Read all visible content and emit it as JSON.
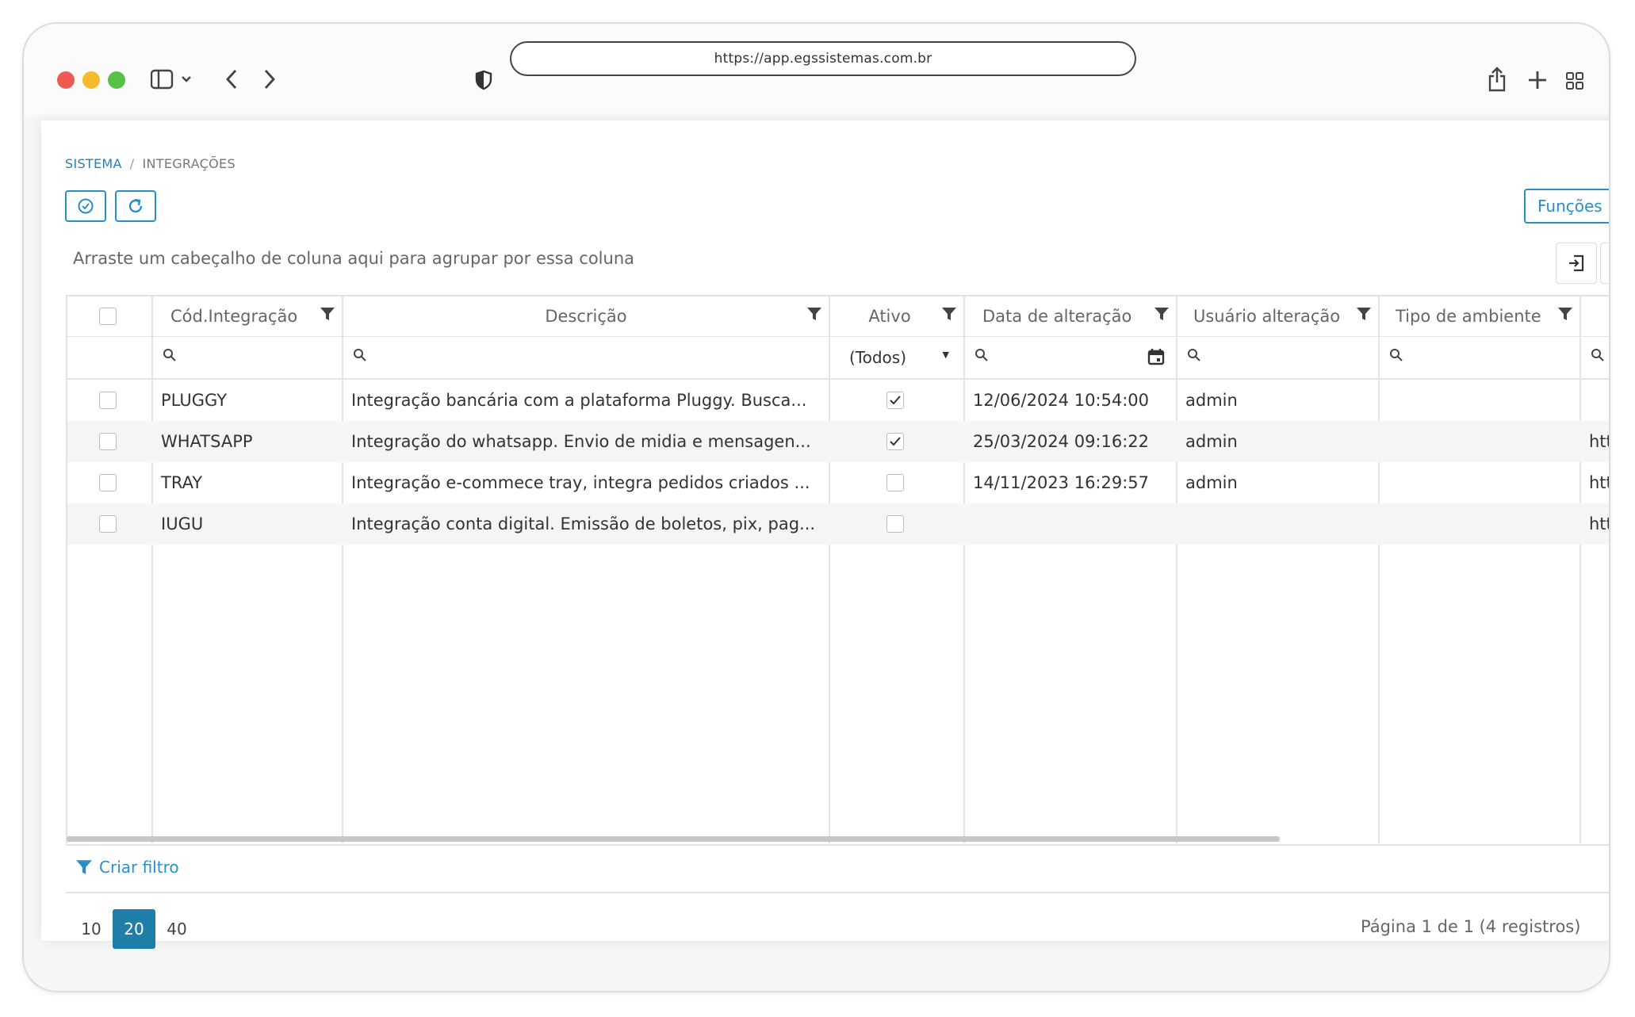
{
  "browser": {
    "url": "https://app.egssistemas.com.br"
  },
  "breadcrumb": {
    "root": "SISTEMA",
    "separator": "/",
    "current": "INTEGRAÇÕES"
  },
  "toolbar": {
    "funcoes_label": "Funções"
  },
  "grid": {
    "group_hint": "Arraste um cabeçalho de coluna aqui para agrupar por essa coluna",
    "columns": [
      "Cód.Integração",
      "Descrição",
      "Ativo",
      "Data de alteração",
      "Usuário alteração",
      "Tipo de ambiente"
    ],
    "ativo_filter_value": "(Todos)",
    "rows": [
      {
        "codigo": "PLUGGY",
        "descricao": "Integração bancária com a plataforma Pluggy. Busca...",
        "ativo": true,
        "data": "12/06/2024 10:54:00",
        "usuario": "admin",
        "extra": ""
      },
      {
        "codigo": "WHATSAPP",
        "descricao": "Integração do whatsapp. Envio de midia e mensagen...",
        "ativo": true,
        "data": "25/03/2024 09:16:22",
        "usuario": "admin",
        "extra": "htt"
      },
      {
        "codigo": "TRAY",
        "descricao": "Integração e-commece tray, integra pedidos criados ...",
        "ativo": false,
        "data": "14/11/2023 16:29:57",
        "usuario": "admin",
        "extra": "htt"
      },
      {
        "codigo": "IUGU",
        "descricao": "Integração conta digital. Emissão de boletos, pix, pag...",
        "ativo": false,
        "data": "",
        "usuario": "",
        "extra": "htt"
      }
    ]
  },
  "filter_bar": {
    "criar_filtro": "Criar filtro"
  },
  "pagination": {
    "page_sizes": [
      "10",
      "20",
      "40"
    ],
    "active_page_size": "20",
    "info": "Página 1 de 1 (4 registros)",
    "current_page": "1"
  },
  "colors": {
    "accent": "#2a8ec9",
    "active_page": "#1f7ea8"
  }
}
